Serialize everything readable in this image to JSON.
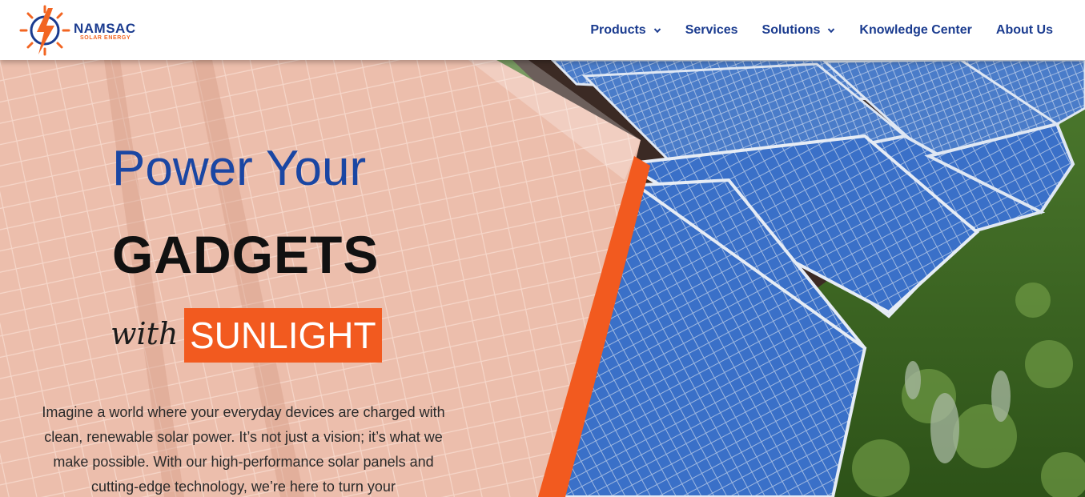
{
  "brand": {
    "name": "NAMSAC",
    "tagline": "SOLAR ENERGY",
    "logo_icon": "sun-bolt-icon",
    "colors": {
      "navy": "#1a3b8f",
      "orange": "#f26522"
    }
  },
  "nav": {
    "items": [
      {
        "label": "Products",
        "dropdown": true
      },
      {
        "label": "Services",
        "dropdown": false
      },
      {
        "label": "Solutions",
        "dropdown": true
      },
      {
        "label": "Knowledge Center",
        "dropdown": false
      },
      {
        "label": "About Us",
        "dropdown": false
      }
    ]
  },
  "hero": {
    "line1": "Power Your",
    "line2": "GADGETS",
    "line3_script": "with",
    "line3_highlight": "SUNLIGHT",
    "paragraph": "Imagine a world where your everyday devices are charged with clean, renewable solar power. It’s not just a vision; it’s what we make possible. With our high-performance solar panels and cutting-edge technology, we’re here to turn your",
    "colors": {
      "headline_blue": "#1a46a3",
      "accent_orange": "#f25a1f",
      "overlay": "#f4c9b8"
    }
  }
}
